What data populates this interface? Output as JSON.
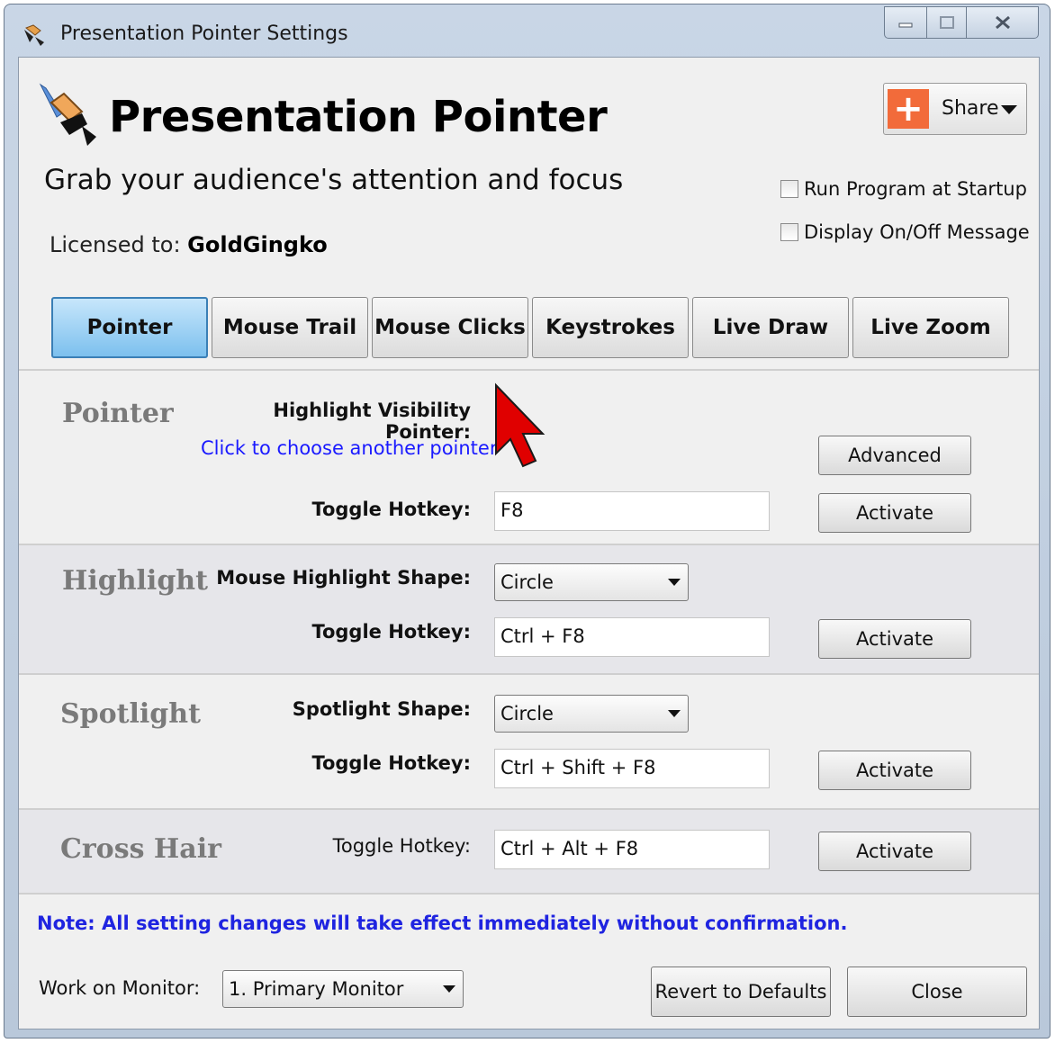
{
  "window": {
    "title": "Presentation Pointer Settings"
  },
  "header": {
    "app_title": "Presentation Pointer",
    "tagline": "Grab your audience's attention and focus",
    "licensed_prefix": "Licensed to:",
    "licensed_user": "GoldGingko",
    "share_label": "Share"
  },
  "options": {
    "run_at_startup": {
      "label": "Run Program at Startup",
      "checked": false
    },
    "display_message": {
      "label": "Display On/Off Message",
      "checked": false
    }
  },
  "tabs": [
    {
      "label": "Pointer",
      "active": true
    },
    {
      "label": "Mouse Trail",
      "active": false
    },
    {
      "label": "Mouse Clicks",
      "active": false
    },
    {
      "label": "Keystrokes",
      "active": false
    },
    {
      "label": "Live Draw",
      "active": false
    },
    {
      "label": "Live Zoom",
      "active": false
    }
  ],
  "pointer": {
    "title": "Pointer",
    "visibility_label": "Highlight Visibility Pointer:",
    "choose_link": "Click to choose another pointer",
    "advanced": "Advanced",
    "hotkey_label": "Toggle Hotkey:",
    "hotkey": "F8",
    "activate": "Activate"
  },
  "highlight": {
    "title": "Highlight",
    "shape_label": "Mouse Highlight Shape:",
    "shape": "Circle",
    "hotkey_label": "Toggle Hotkey:",
    "hotkey": "Ctrl + F8",
    "activate": "Activate"
  },
  "spotlight": {
    "title": "Spotlight",
    "shape_label": "Spotlight Shape:",
    "shape": "Circle",
    "hotkey_label": "Toggle Hotkey:",
    "hotkey": "Ctrl + Shift + F8",
    "activate": "Activate"
  },
  "crosshair": {
    "title": "Cross Hair",
    "hotkey_label": "Toggle Hotkey:",
    "hotkey": "Ctrl + Alt + F8",
    "activate": "Activate"
  },
  "footer": {
    "note": "Note: All setting changes will take effect immediately without confirmation.",
    "monitor_label": "Work on Monitor:",
    "monitor": "1. Primary Monitor",
    "revert": "Revert to Defaults",
    "close": "Close"
  },
  "colors": {
    "accent_tab": "#7cc0ee",
    "link": "#1a1aff",
    "note": "#1f24e0",
    "share_plus": "#f26b3a",
    "pointer_arrow": "#e00000"
  },
  "icons": {
    "app_icon": "pointer-pen-icon",
    "pointer_preview": "red-arrow-pointer-icon"
  }
}
